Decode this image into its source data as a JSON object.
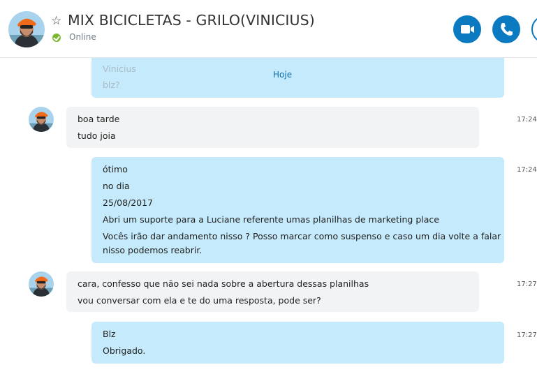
{
  "header": {
    "title": "MIX BICICLETAS - GRILO(VINICIUS)",
    "status": "Online"
  },
  "chat": {
    "previous": {
      "lines": [
        "Vinicius",
        "blz?"
      ]
    },
    "day_label": "Hoje",
    "messages": [
      {
        "direction": "in",
        "lines": [
          "boa tarde",
          "tudo joia"
        ],
        "time": "17:24"
      },
      {
        "direction": "out",
        "lines": [
          "ótimo",
          "no dia",
          "25/08/2017",
          "Abri um suporte para a Luciane referente umas planilhas de marketing place",
          "Vocês irão dar andamento nisso ? Posso marcar como suspenso e caso um dia volte a falar",
          "nisso podemos reabrir."
        ],
        "time": "17:24"
      },
      {
        "direction": "in",
        "lines": [
          "cara, confesso que não sei nada sobre a abertura dessas planilhas",
          "vou conversar com ela e te do uma resposta, pode ser?"
        ],
        "time": "17:27"
      },
      {
        "direction": "out",
        "lines": [
          "Blz",
          "Obrigado."
        ],
        "time": "17:27"
      }
    ]
  },
  "colors": {
    "accent": "#0c7ac1",
    "online": "#7cb82f",
    "incoming_bubble": "#f1f3f5",
    "outgoing_bubble": "#c5eafb"
  },
  "icons": [
    "star-icon",
    "online-status-icon",
    "video-call-icon",
    "phone-icon",
    "add-participant-icon",
    "contact-avatar"
  ]
}
